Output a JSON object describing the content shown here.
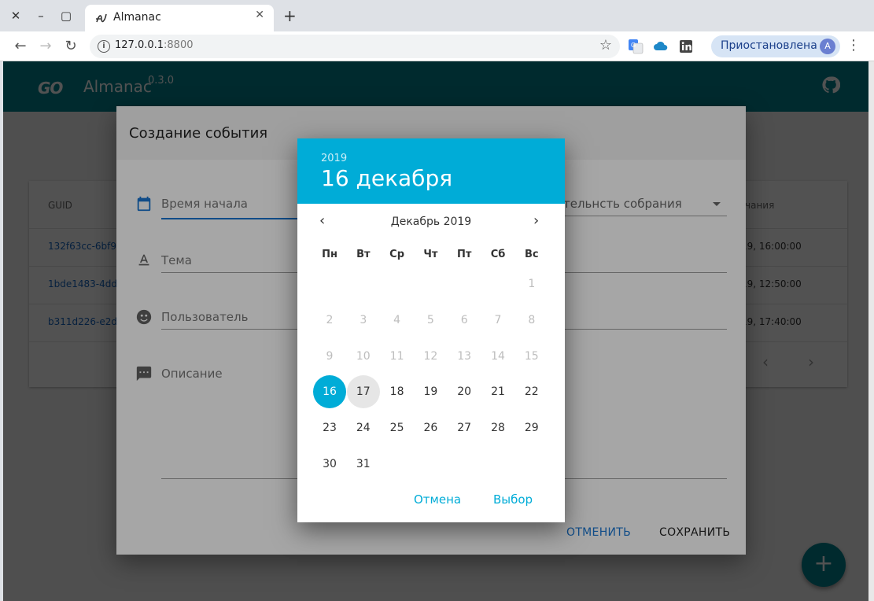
{
  "browser": {
    "tab_title": "Almanac",
    "url_host": "127.0.0.1",
    "url_port": ":8800",
    "profile_label": "Приостановлена",
    "profile_initial": "A"
  },
  "app": {
    "logo_text": "GO",
    "name": "Almanac",
    "version": "0.3.0"
  },
  "table": {
    "headers": [
      "GUID",
      "чания"
    ],
    "rows": [
      {
        "guid": "132f63cc-6bf9-",
        "end": "19, 16:00:00"
      },
      {
        "guid": "1bde1483-4dd",
        "end": "19, 12:50:00"
      },
      {
        "guid": "b311d226-e2d",
        "end": "19, 17:40:00"
      }
    ],
    "pager_prev": "‹",
    "pager_next": "›"
  },
  "dialog": {
    "title": "Создание события",
    "start_time_label": "Время начала",
    "duration_label": "тельнсть собрания",
    "topic_label": "Тема",
    "user_label": "Пользователь",
    "description_label": "Описание",
    "cancel_label": "ОТМЕНИТЬ",
    "save_label": "СОХРАНИТЬ"
  },
  "picker": {
    "year": "2019",
    "date_title": "16 декабря",
    "month_label": "Декабрь 2019",
    "weekdays": [
      "Пн",
      "Вт",
      "Ср",
      "Чт",
      "Пт",
      "Сб",
      "Вс"
    ],
    "first_weekday_index": 6,
    "days_in_month": 31,
    "last_disabled_day": 15,
    "selected_day": 16,
    "hover_day": 17,
    "cancel_label": "Отмена",
    "ok_label": "Выбор"
  },
  "colors": {
    "appbar": "#00838f",
    "picker_accent": "#00acd7",
    "dialog_action": "#1976d2"
  },
  "fab_label": "+"
}
